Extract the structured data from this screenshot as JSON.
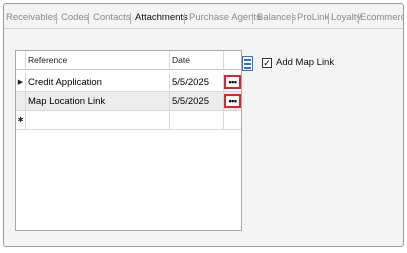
{
  "tabs": [
    {
      "label": "Receivables",
      "active": false
    },
    {
      "label": "Codes",
      "active": false
    },
    {
      "label": "Contacts",
      "active": false
    },
    {
      "label": "Attachments",
      "active": true
    },
    {
      "label": "Purchase Agents",
      "active": false
    },
    {
      "label": "Balances",
      "active": false
    },
    {
      "label": "ProLink",
      "active": false
    },
    {
      "label": "Loyalty",
      "active": false
    },
    {
      "label": "Ecommerce",
      "active": false
    }
  ],
  "grid": {
    "headers": {
      "reference": "Reference",
      "date": "Date"
    },
    "rows": [
      {
        "indicator": "▶",
        "reference": "Credit Application",
        "date": "5/5/2025",
        "action": "•••"
      },
      {
        "indicator": "",
        "reference": "Map Location Link",
        "date": "5/5/2025",
        "action": "•••"
      }
    ],
    "new_row_indicator": "✱"
  },
  "options": {
    "add_map_link_label": "Add Map Link",
    "add_map_link_checked": "✓"
  },
  "colors": {
    "highlight": "#d9262b",
    "accent": "#2f6fd3"
  }
}
